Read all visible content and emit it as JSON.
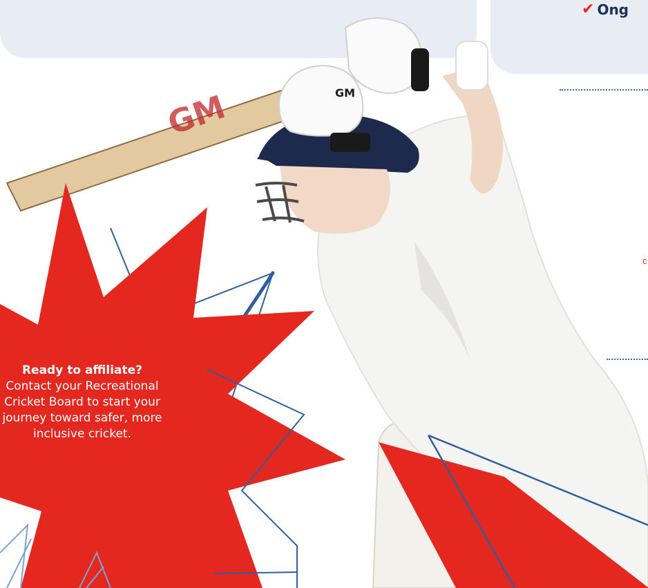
{
  "header_right": {
    "check_icon": "check-icon",
    "text": "Ong"
  },
  "aside": {
    "letter": "c"
  },
  "callout": {
    "title": "Ready to affiliate?",
    "body": "Contact your Recreational Cricket Board to start your journey toward safer, more inclusive cricket."
  },
  "colors": {
    "accent_red": "#e5281f",
    "navy": "#1b2f57",
    "card_bg": "#e8edf3",
    "line_blue": "#3a6aa8"
  },
  "photo": {
    "subject": "batter-photo",
    "bat_brand": "GM",
    "glove_brand": "GM"
  }
}
